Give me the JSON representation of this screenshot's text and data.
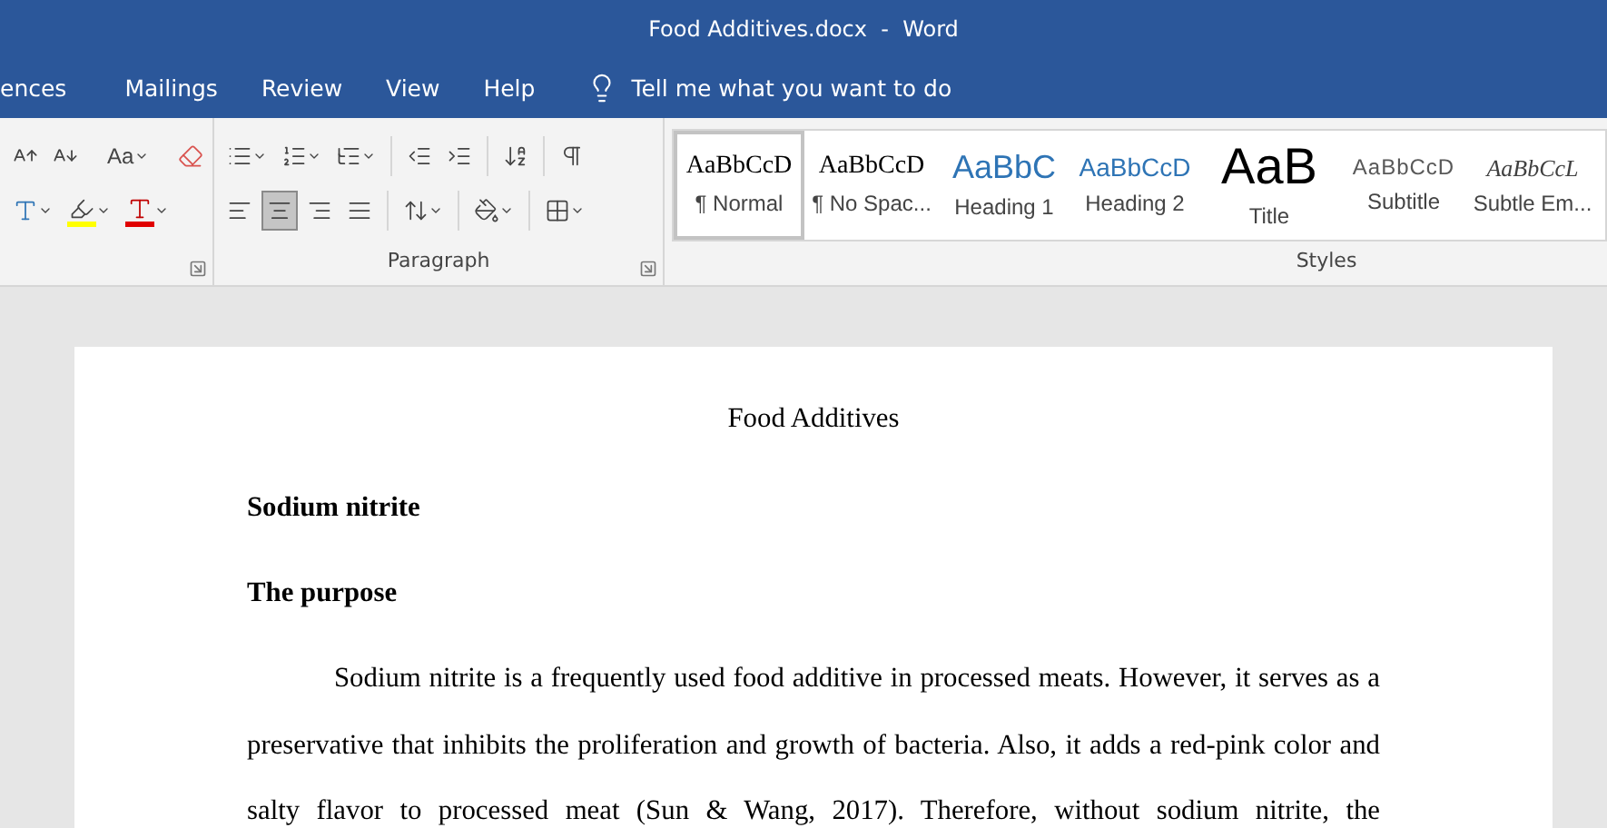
{
  "window": {
    "title": "Food Additives.docx  -  Word"
  },
  "tabs": [
    {
      "label": "ences",
      "selected": false
    },
    {
      "label": "Mailings",
      "selected": false
    },
    {
      "label": "Review",
      "selected": false
    },
    {
      "label": "View",
      "selected": false
    },
    {
      "label": "Help",
      "selected": false
    }
  ],
  "tell_me": {
    "placeholder": "Tell me what you want to do"
  },
  "font_group": {
    "row1": [
      {
        "kind": "grow"
      },
      {
        "kind": "shrink"
      },
      {
        "kind": "case",
        "label": "Aa"
      },
      {
        "kind": "clear"
      }
    ],
    "row2": [
      {
        "kind": "effects"
      },
      {
        "kind": "highlight"
      },
      {
        "kind": "color"
      }
    ]
  },
  "paragraph_group": {
    "label": "Paragraph",
    "row1": [
      {
        "kind": "bullets"
      },
      {
        "kind": "numbering"
      },
      {
        "kind": "multilevel"
      },
      {
        "kind": "outdent"
      },
      {
        "kind": "indent"
      },
      {
        "kind": "sort"
      },
      {
        "kind": "marks"
      }
    ],
    "alignment": [
      {
        "kind": "left",
        "selected": false
      },
      {
        "kind": "center",
        "selected": true
      },
      {
        "kind": "right",
        "selected": false
      },
      {
        "kind": "justify",
        "selected": false
      }
    ],
    "row2": [
      {
        "kind": "spacing"
      },
      {
        "kind": "shading"
      },
      {
        "kind": "borders"
      }
    ]
  },
  "styles_group": {
    "label": "Styles",
    "styles": [
      {
        "preview": "AaBbCcD",
        "name": "¶ Normal",
        "kind": "normal",
        "selected": true
      },
      {
        "preview": "AaBbCcD",
        "name": "¶ No Spac...",
        "kind": "normal",
        "selected": false
      },
      {
        "preview": "AaBbC",
        "name": "Heading 1",
        "kind": "heading1",
        "selected": false
      },
      {
        "preview": "AaBbCcD",
        "name": "Heading 2",
        "kind": "heading2",
        "selected": false
      },
      {
        "preview": "AaB",
        "name": "Title",
        "kind": "title",
        "selected": false
      },
      {
        "preview": "AaBbCcD",
        "name": "Subtitle",
        "kind": "subtitle",
        "selected": false
      },
      {
        "preview": "AaBbCcL",
        "name": "Subtle Em...",
        "kind": "emphasis",
        "selected": false
      }
    ]
  },
  "document": {
    "title": "Food Additives",
    "blocks": [
      {
        "kind": "heading",
        "text": "Sodium nitrite"
      },
      {
        "kind": "heading",
        "text": "The purpose"
      },
      {
        "kind": "paragraph",
        "text": "Sodium nitrite is a frequently used food additive in processed meats. However, it serves as a preservative that inhibits the proliferation and growth of bacteria. Also, it adds a red-pink color and salty flavor to processed meat (Sun & Wang, 2017). Therefore, without sodium nitrite, the"
      }
    ]
  }
}
